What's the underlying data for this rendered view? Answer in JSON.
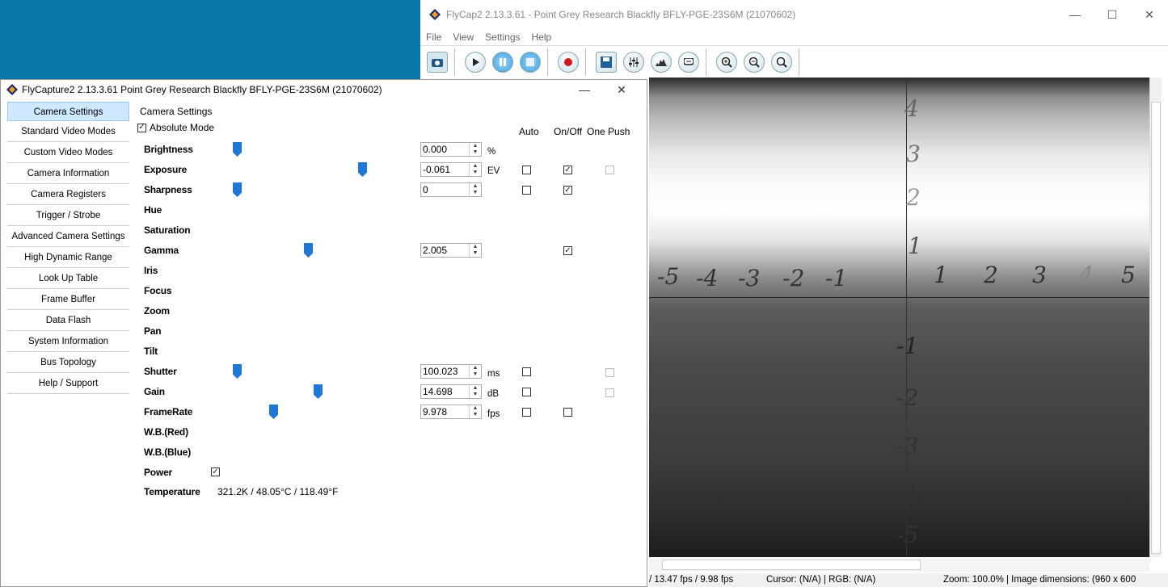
{
  "main_window": {
    "title": "FlyCap2 2.13.3.61 - Point Grey Research Blackfly BFLY-PGE-23S6M (21070602)",
    "controls": {
      "minimize": "—",
      "maximize": "☐",
      "close": "✕"
    },
    "menu": [
      "File",
      "View",
      "Settings",
      "Help"
    ],
    "toolbar_icons": [
      "camera-select-icon",
      "play-icon",
      "pause-icon",
      "stop-icon",
      "record-icon",
      "save-icon",
      "settings-sliders-icon",
      "histogram-icon",
      "event-stats-icon",
      "zoom-in-icon",
      "zoom-out-icon",
      "zoom-100-icon"
    ],
    "status": {
      "fps": "/ 13.47 fps / 9.98 fps",
      "cursor": "Cursor: (N/A) | RGB: (N/A)",
      "zoom": "Zoom: 100.0% | Image dimensions: (960 x 600"
    },
    "video_axis_labels": {
      "x": [
        "-5",
        "-4",
        "-3",
        "-2",
        "-1",
        "1",
        "2",
        "3",
        "4",
        "5"
      ],
      "y": [
        "4",
        "3",
        "2",
        "1",
        "-1",
        "-2",
        "-3",
        "-4",
        "-5"
      ]
    }
  },
  "dialog": {
    "title": "FlyCapture2 2.13.3.61  Point Grey Research Blackfly BFLY-PGE-23S6M (21070602)",
    "controls": {
      "minimize": "—",
      "close": "✕"
    },
    "nav": [
      "Camera Settings",
      "Standard Video Modes",
      "Custom Video Modes",
      "Camera Information",
      "Camera Registers",
      "Trigger / Strobe",
      "Advanced Camera Settings",
      "High Dynamic Range",
      "Look Up Table",
      "Frame Buffer",
      "Data Flash",
      "System Information",
      "Bus Topology",
      "Help / Support"
    ],
    "active_nav": "Camera Settings",
    "panel_title": "Camera Settings",
    "absolute_mode": {
      "label": "Absolute Mode",
      "checked": true
    },
    "headers": {
      "auto": "Auto",
      "onoff": "On/Off",
      "onepush": "One Push"
    },
    "properties": {
      "brightness": {
        "label": "Brightness",
        "value": "0.000",
        "unit": "%",
        "slider": 0.0
      },
      "exposure": {
        "label": "Exposure",
        "value": "-0.061",
        "unit": "EV",
        "slider": 0.57
      },
      "sharpness": {
        "label": "Sharpness",
        "value": "0",
        "unit": "",
        "slider": 0.0
      },
      "hue": {
        "label": "Hue"
      },
      "saturation": {
        "label": "Saturation"
      },
      "gamma": {
        "label": "Gamma",
        "value": "2.005",
        "unit": "",
        "slider": 0.32
      },
      "iris": {
        "label": "Iris"
      },
      "focus": {
        "label": "Focus"
      },
      "zoom": {
        "label": "Zoom"
      },
      "pan": {
        "label": "Pan"
      },
      "tilt": {
        "label": "Tilt"
      },
      "shutter": {
        "label": "Shutter",
        "value": "100.023",
        "unit": "ms",
        "slider": 0.0
      },
      "gain": {
        "label": "Gain",
        "value": "14.698",
        "unit": "dB",
        "slider": 0.36
      },
      "framerate": {
        "label": "FrameRate",
        "value": "9.978",
        "unit": "fps",
        "slider": 0.16
      },
      "wb_red": {
        "label": "W.B.(Red)"
      },
      "wb_blue": {
        "label": "W.B.(Blue)"
      },
      "power": {
        "label": "Power",
        "checked": true
      },
      "temperature": {
        "label": "Temperature",
        "value": "321.2K / 48.05°C / 118.49°F"
      }
    },
    "checkmark": "✓"
  }
}
